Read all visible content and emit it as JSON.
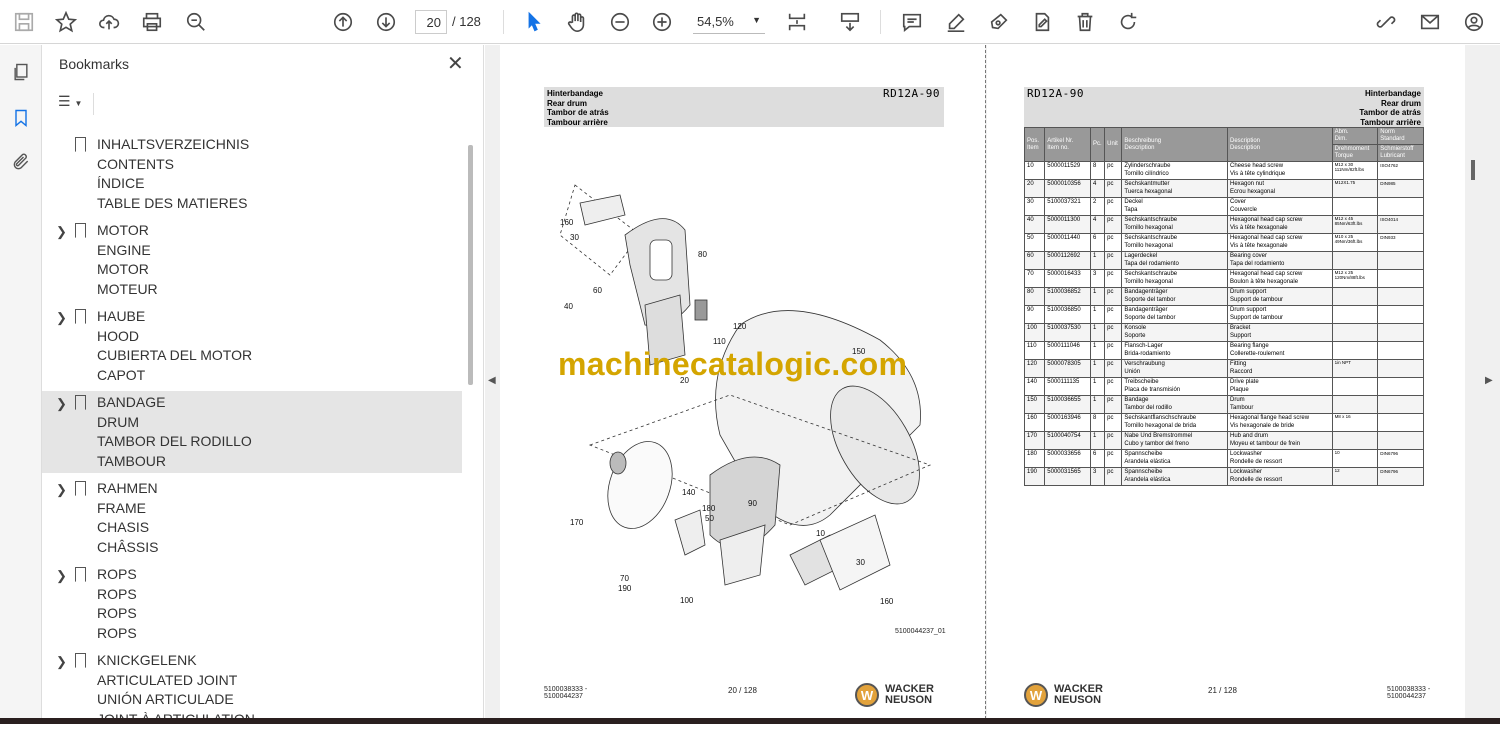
{
  "toolbar": {
    "page_current": "20",
    "page_total": "/ 128",
    "zoom": "54,5%"
  },
  "bookmarks": {
    "title": "Bookmarks",
    "items": [
      {
        "lines": [
          "INHALTSVERZEICHNIS",
          "CONTENTS",
          "ÍNDICE",
          "TABLE DES MATIERES"
        ],
        "expandable": false,
        "selected": false
      },
      {
        "lines": [
          "MOTOR",
          "ENGINE",
          "MOTOR",
          "MOTEUR"
        ],
        "expandable": true,
        "selected": false
      },
      {
        "lines": [
          "HAUBE",
          "HOOD",
          "CUBIERTA DEL MOTOR",
          "CAPOT"
        ],
        "expandable": true,
        "selected": false
      },
      {
        "lines": [
          "BANDAGE",
          "DRUM",
          "TAMBOR DEL RODILLO",
          "TAMBOUR"
        ],
        "expandable": true,
        "selected": true
      },
      {
        "lines": [
          "RAHMEN",
          "FRAME",
          "CHASIS",
          "CHÂSSIS"
        ],
        "expandable": true,
        "selected": false
      },
      {
        "lines": [
          "ROPS",
          "ROPS",
          "ROPS",
          "ROPS"
        ],
        "expandable": true,
        "selected": false
      },
      {
        "lines": [
          "KNICKGELENK",
          "ARTICULATED JOINT",
          "UNIÓN ARTICULADE",
          "JOINT À ARTICULATION"
        ],
        "expandable": true,
        "selected": false
      }
    ]
  },
  "left_page": {
    "titles": [
      "Hinterbandage",
      "Rear drum",
      "Tambor de atrás",
      "Tambour arrière"
    ],
    "model": "RD12A-90",
    "drawing_no": "5100044237_01",
    "doc_no": [
      "5100038333 -",
      "5100044237"
    ],
    "page_label": "20 / 128",
    "callouts": [
      "160",
      "30",
      "80",
      "60",
      "40",
      "120",
      "110",
      "20",
      "150",
      "140",
      "170",
      "180",
      "50",
      "90",
      "10",
      "70",
      "190",
      "100",
      "30",
      "160"
    ]
  },
  "right_page": {
    "model": "RD12A-90",
    "titles": [
      "Hinterbandage",
      "Rear drum",
      "Tambor de atrás",
      "Tambour arrière"
    ],
    "page_label": "21 / 128",
    "doc_no": [
      "5100038333 -",
      "5100044237"
    ],
    "table_headers": {
      "pos": [
        "Pos.",
        "Item"
      ],
      "art": [
        "Artikel Nr.",
        "Item no."
      ],
      "pc": "Pc.",
      "unit": "Unit",
      "desc_de": [
        "Beschreibung",
        "Description"
      ],
      "desc_en": [
        "Description",
        "Description"
      ],
      "dim": [
        "Abm.",
        "Dim."
      ],
      "torque": [
        "Drehmoment",
        "Torque"
      ],
      "std": [
        "Norm",
        "Standard"
      ],
      "lub": [
        "Schmierstoff",
        "Lubricant"
      ]
    },
    "rows": [
      [
        "10",
        "5000011529",
        "8",
        "pc",
        "Zylinderschraube",
        "Tornillo cilíndrico",
        "Cheese head screw",
        "Vis à tête cylindrique",
        "M12 x 30",
        "111Nm/82ft.lbs",
        "ISO4762"
      ],
      [
        "20",
        "5000010356",
        "4",
        "pc",
        "Sechskantmutter",
        "Tuerca hexagonal",
        "Hexagon nut",
        "Ecrou hexagonal",
        "M12X1.75",
        "",
        "DIN985"
      ],
      [
        "30",
        "5100037321",
        "2",
        "pc",
        "Deckel",
        "Tapa",
        "Cover",
        "Couvercle",
        "",
        "",
        ""
      ],
      [
        "40",
        "5000011300",
        "4",
        "pc",
        "Sechskantschraube",
        "Tornillo hexagonal",
        "Hexagonal head cap screw",
        "Vis à tête hexagonale",
        "M12 x 45",
        "85Nm/63ft.lbs",
        "ISO4014"
      ],
      [
        "50",
        "5000011440",
        "6",
        "pc",
        "Sechskantschraube",
        "Tornillo hexagonal",
        "Hexagonal head cap screw",
        "Vis à tête hexagonale",
        "M10 x 25",
        "49Nm/36ft.lbs",
        "DIN933"
      ],
      [
        "60",
        "5000112692",
        "1",
        "pc",
        "Lagerdeckel",
        "Tapa del rodamiento",
        "Bearing cover",
        "Tapa del rodamiento",
        "",
        "",
        ""
      ],
      [
        "70",
        "5000016433",
        "3",
        "pc",
        "Sechskantschraube",
        "Tornillo hexagonal",
        "Hexagonal head cap screw",
        "Boulon à tête hexagonale",
        "M12 x 25",
        "120Nm/88ft.lbs",
        ""
      ],
      [
        "80",
        "5100036852",
        "1",
        "pc",
        "Bandagenträger",
        "Soporte del tambor",
        "Drum support",
        "Support de tambour",
        "",
        "",
        ""
      ],
      [
        "90",
        "5100036850",
        "1",
        "pc",
        "Bandagenträger",
        "Soporte del tambor",
        "Drum support",
        "Support de tambour",
        "",
        "",
        ""
      ],
      [
        "100",
        "5100037530",
        "1",
        "pc",
        "Konsole",
        "Soporte",
        "Bracket",
        "Support",
        "",
        "",
        ""
      ],
      [
        "110",
        "5000111046",
        "1",
        "pc",
        "Flansch-Lager",
        "Brida-rodamiento",
        "Bearing flange",
        "Collerette-roulement",
        "",
        "",
        ""
      ],
      [
        "120",
        "5000078305",
        "1",
        "pc",
        "Verschraubung",
        "Unión",
        "Fitting",
        "Raccord",
        "1in NPT",
        "",
        ""
      ],
      [
        "140",
        "5000111135",
        "1",
        "pc",
        "Treibscheibe",
        "Placa de transmisión",
        "Drive plate",
        "Plaque",
        "",
        "",
        ""
      ],
      [
        "150",
        "5100036655",
        "1",
        "pc",
        "Bandage",
        "Tambor del rodillo",
        "Drum",
        "Tambour",
        "",
        "",
        ""
      ],
      [
        "160",
        "5000163946",
        "8",
        "pc",
        "Sechskantflanschschraube",
        "Tornillo hexagonal de brida",
        "Hexagonal flange head screw",
        "Vis hexagonale de bride",
        "M8 x 16",
        "",
        ""
      ],
      [
        "170",
        "5100040754",
        "1",
        "pc",
        "Nabe Und Bremstrommel",
        "Cubo y tambor del freno",
        "Hub and drum",
        "Moyeu et tambour de frein",
        "",
        "",
        ""
      ],
      [
        "180",
        "5000033656",
        "6",
        "pc",
        "Spannscheibe",
        "Arandela elástica",
        "Lockwasher",
        "Rondelle de ressort",
        "10",
        "",
        "DIN6796"
      ],
      [
        "190",
        "5000031565",
        "3",
        "pc",
        "Spannscheibe",
        "Arandela elástica",
        "Lockwasher",
        "Rondelle de ressort",
        "12",
        "",
        "DIN6796"
      ]
    ]
  },
  "brand": {
    "name_lines": [
      "WACKER",
      "NEUSON"
    ],
    "mark": "W"
  },
  "watermark": "machinecatalogic.com"
}
